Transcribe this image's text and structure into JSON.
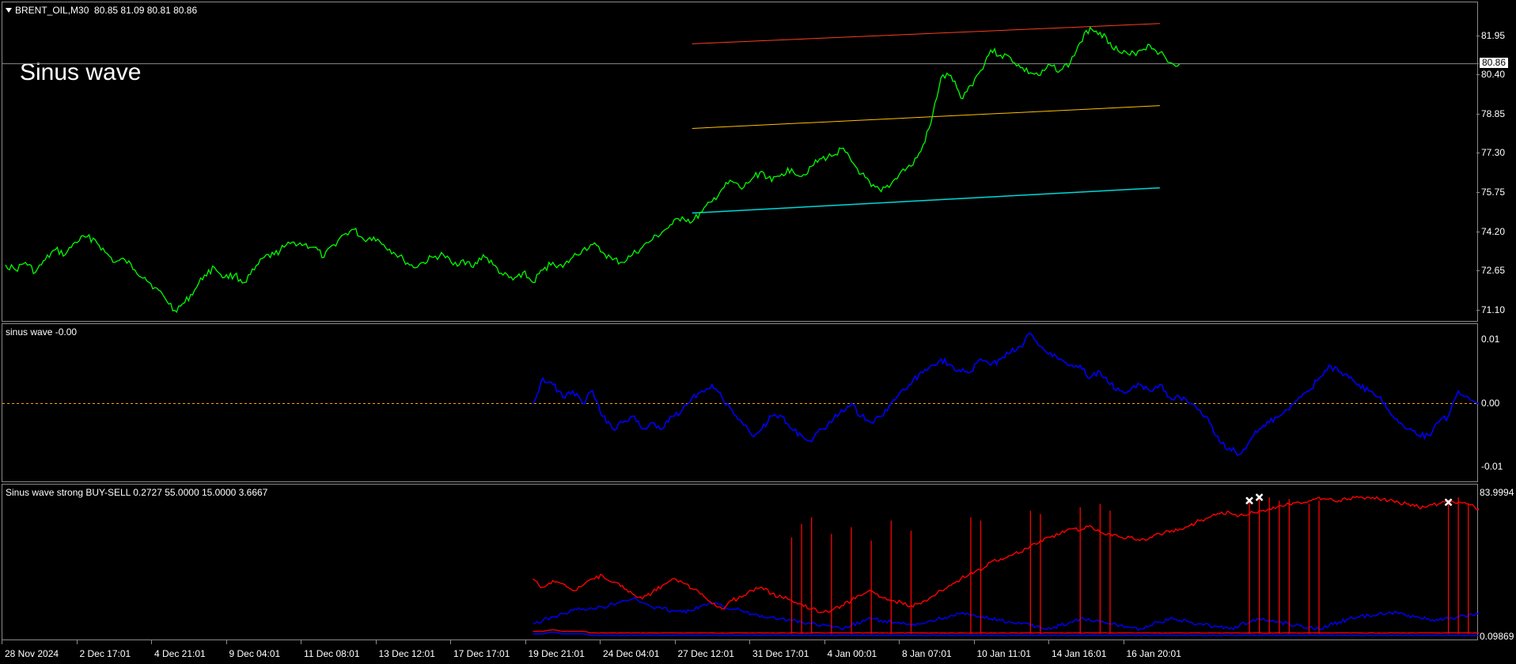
{
  "header": {
    "symbol_line": "BRENT_OIL,M30  80.85 81.09 80.81 80.86",
    "overlay_title": "Sinus wave",
    "current_price": "80.86"
  },
  "panes": {
    "sinus": {
      "label": "sinus wave -0.00"
    },
    "strong": {
      "label": "Sinus wave strong BUY-SELL 0.2727 55.0000 15.0000 3.6667"
    }
  },
  "colors": {
    "price": "#00ff00",
    "channel_upper": "#ff3c1e",
    "channel_middle": "#ffc000",
    "channel_lower": "#00d8d8",
    "sinus_line": "#0000ff",
    "zero_line": "#ffa500",
    "strong_red": "#ff0000",
    "strong_blue": "#0000ff",
    "markers": "#ffffff"
  },
  "chart_data": [
    {
      "type": "line",
      "title": "BRENT_OIL,M30",
      "yticks": [
        "81.95",
        "80.40",
        "78.85",
        "77.30",
        "75.75",
        "74.20",
        "72.65",
        "71.10"
      ],
      "ylim": [
        70.9,
        83.1
      ],
      "x_ticks": [
        "28 Nov 2024",
        "2 Dec 17:01",
        "4 Dec 21:01",
        "9 Dec 04:01",
        "11 Dec 08:01",
        "13 Dec 12:01",
        "17 Dec 17:01",
        "19 Dec 21:01",
        "24 Dec 04:01",
        "27 Dec 12:01",
        "31 Dec 17:01",
        "4 Jan 00:01",
        "8 Jan 07:01",
        "10 Jan 11:01",
        "14 Jan 16:01",
        "16 Jan 20:01"
      ],
      "series": [
        {
          "values": [
            72.9,
            72.7,
            73.0,
            72.6,
            73.1,
            73.5,
            73.3,
            73.8,
            74.0,
            73.9,
            73.4,
            73.0,
            73.1,
            72.7,
            72.4,
            72.0,
            71.6,
            71.1,
            71.4,
            71.9,
            72.5,
            72.8,
            72.4,
            72.5,
            72.2,
            72.7,
            73.2,
            73.3,
            73.6,
            73.8,
            73.7,
            73.6,
            73.2,
            73.7,
            74.1,
            74.3,
            73.9,
            74.0,
            73.7,
            73.4,
            73.1,
            72.8,
            73.0,
            73.2,
            73.3,
            72.9,
            73.1,
            72.8,
            73.3,
            72.9,
            72.5,
            72.3,
            72.6,
            72.2,
            72.7,
            73.0,
            72.8,
            73.2,
            73.5,
            73.7,
            73.4,
            73.1,
            73.0,
            73.3,
            73.6,
            73.9,
            74.2,
            74.5,
            74.8,
            74.6,
            75.0,
            75.4,
            75.9,
            76.2,
            75.9,
            76.3,
            76.6,
            76.2,
            76.5,
            76.7,
            76.4,
            76.8,
            77.1,
            77.2,
            77.5,
            77.0,
            76.5,
            76.0,
            75.8,
            76.1,
            76.6,
            76.8,
            77.4,
            78.5,
            80.3,
            80.4,
            79.5,
            80.0,
            80.6,
            81.4,
            81.2,
            81.1,
            80.7,
            80.5,
            80.4,
            80.8,
            80.6,
            80.9,
            81.7,
            82.3,
            82.1,
            81.7,
            81.3,
            81.2,
            81.4,
            81.6,
            81.3,
            80.9,
            80.86
          ]
        }
      ],
      "channel": {
        "x_start_index": 69,
        "x_end_index": 116,
        "upper": [
          81.65,
          82.45
        ],
        "middle": [
          78.3,
          79.2
        ],
        "lower": [
          74.95,
          75.95
        ]
      }
    },
    {
      "type": "line",
      "title": "sinus wave",
      "yticks": [
        "0.01",
        "0.00",
        "-0.01"
      ],
      "ylim": [
        -0.0115,
        0.0115
      ],
      "reference_line": 0.0,
      "x_start_index": 53,
      "series": [
        {
          "values": [
            0.0,
            0.004,
            0.003,
            0.001,
            0.002,
            0.0,
            0.002,
            -0.002,
            -0.004,
            -0.003,
            -0.002,
            -0.004,
            -0.003,
            -0.004,
            -0.002,
            -0.001,
            0.001,
            0.002,
            0.003,
            0.001,
            -0.001,
            -0.003,
            -0.005,
            -0.004,
            -0.002,
            -0.002,
            -0.004,
            -0.005,
            -0.006,
            -0.004,
            -0.003,
            -0.001,
            0.0,
            -0.002,
            -0.003,
            -0.002,
            0.0,
            0.002,
            0.003,
            0.005,
            0.006,
            0.007,
            0.006,
            0.005,
            0.005,
            0.007,
            0.006,
            0.007,
            0.008,
            0.009,
            0.011,
            0.009,
            0.008,
            0.007,
            0.006,
            0.006,
            0.004,
            0.005,
            0.003,
            0.002,
            0.002,
            0.003,
            0.002,
            0.003,
            0.001,
            0.001,
            0.0,
            -0.001,
            -0.003,
            -0.006,
            -0.007,
            -0.008,
            -0.006,
            -0.004,
            -0.003,
            -0.002,
            -0.001,
            0.001,
            0.002,
            0.004,
            0.006,
            0.005,
            0.004,
            0.003,
            0.002,
            0.001,
            -0.001,
            -0.003,
            -0.004,
            -0.005,
            -0.005,
            -0.003,
            -0.002,
            0.002,
            0.001,
            0.0,
            -0.001,
            -0.003,
            -0.004,
            -0.005,
            -0.006
          ]
        }
      ]
    },
    {
      "type": "line",
      "title": "Sinus wave strong BUY-SELL",
      "yticks": [
        "83.9994",
        "0.09869"
      ],
      "ylim": [
        0,
        85
      ],
      "x_start_index": 53,
      "series": [
        {
          "values": [
            35,
            30,
            34,
            32,
            28,
            31,
            35,
            37,
            33,
            31,
            26,
            23,
            27,
            31,
            35,
            33,
            29,
            26,
            20,
            17,
            22,
            24,
            28,
            30,
            26,
            24,
            22,
            20,
            17,
            15,
            16,
            19,
            22,
            25,
            28,
            24,
            22,
            21,
            19,
            20,
            24,
            28,
            31,
            35,
            39,
            40,
            45,
            47,
            49,
            51,
            55,
            58,
            60,
            62,
            65,
            64,
            67,
            63,
            62,
            60,
            60,
            58,
            60,
            62,
            63,
            65,
            67,
            70,
            72,
            74,
            75,
            73,
            74,
            76,
            77,
            79,
            80,
            81,
            82,
            84,
            83,
            82,
            83,
            84,
            84,
            83,
            82,
            81,
            80,
            78,
            79,
            80,
            82,
            81,
            80,
            77,
            75,
            73,
            74,
            75,
            65
          ]
        },
        {
          "values": [
            8,
            10,
            12,
            14,
            16,
            17,
            17,
            18,
            20,
            22,
            23,
            21,
            18,
            17,
            16,
            15,
            16,
            19,
            20,
            19,
            17,
            16,
            14,
            13,
            12,
            11,
            10,
            9,
            8,
            7,
            6,
            5,
            7,
            9,
            11,
            10,
            9,
            8,
            7,
            8,
            10,
            11,
            13,
            14,
            13,
            12,
            11,
            10,
            9,
            8,
            7,
            6,
            5,
            7,
            9,
            11,
            10,
            9,
            8,
            7,
            6,
            5,
            7,
            9,
            11,
            10,
            9,
            8,
            7,
            6,
            5,
            7,
            9,
            11,
            10,
            9,
            8,
            7,
            6,
            5,
            7,
            9,
            11,
            12,
            13,
            14,
            15,
            14,
            13,
            12,
            11,
            10,
            11,
            12,
            13,
            14,
            15,
            14,
            13,
            12,
            11,
            10,
            9,
            8,
            7,
            6
          ]
        },
        {
          "values": [
            2,
            2,
            3,
            2,
            2,
            2,
            1,
            1,
            1,
            1,
            1,
            1,
            1,
            1,
            1,
            1,
            1,
            1,
            1,
            1,
            1,
            1,
            1,
            1,
            1,
            1,
            1,
            1,
            1,
            1,
            1,
            1,
            1,
            1,
            1,
            1,
            1,
            1,
            1,
            1,
            1,
            1,
            1,
            1,
            1,
            1,
            1,
            1,
            1,
            1,
            1,
            1,
            1,
            1,
            1,
            1,
            1,
            1,
            1,
            1,
            1,
            1,
            1,
            1,
            1,
            1,
            1,
            1,
            1,
            1,
            1,
            1,
            1,
            1,
            1,
            1,
            1,
            1,
            1,
            1,
            1,
            1,
            1,
            1,
            1,
            1,
            1,
            1,
            1,
            1,
            1,
            1,
            1,
            1,
            1,
            1,
            1,
            1,
            1,
            1,
            1,
            1
          ]
        }
      ]
    }
  ]
}
